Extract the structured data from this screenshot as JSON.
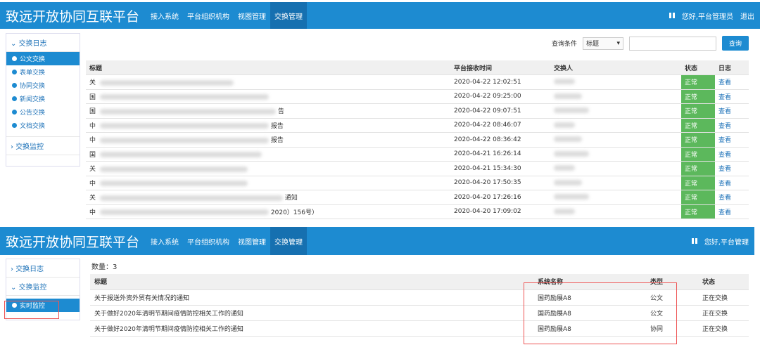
{
  "top": {
    "app_title": "致远开放协同互联平台",
    "nav": [
      "接入系统",
      "平台组织机构",
      "视图管理",
      "交换管理"
    ],
    "greeting": "您好,平台管理员",
    "logout": "退出"
  },
  "top_sidebar": {
    "sections": [
      "交换日志",
      "交换监控"
    ],
    "items": [
      "公文交换",
      "表单交换",
      "协同交换",
      "新闻交换",
      "公告交换",
      "文档交换"
    ]
  },
  "filter": {
    "label": "查询条件",
    "select": "标题",
    "button": "查询"
  },
  "log_table": {
    "headers": [
      "标题",
      "平台接收时间",
      "交换人",
      "状态",
      "日志"
    ],
    "rows": [
      {
        "title": "关",
        "suffix": "",
        "time": "2020-04-22 12:02:51",
        "status": "正常",
        "log": "查看"
      },
      {
        "title": "国",
        "suffix": "",
        "time": "2020-04-22 09:25:00",
        "status": "正常",
        "log": "查看"
      },
      {
        "title": "国",
        "suffix": "告",
        "time": "2020-04-22 09:07:51",
        "status": "正常",
        "log": "查看"
      },
      {
        "title": "中",
        "suffix": "报告",
        "time": "2020-04-22 08:46:07",
        "status": "正常",
        "log": "查看"
      },
      {
        "title": "中",
        "suffix": "报告",
        "time": "2020-04-22 08:36:42",
        "status": "正常",
        "log": "查看"
      },
      {
        "title": "国",
        "suffix": "",
        "time": "2020-04-21 16:26:14",
        "status": "正常",
        "log": "查看"
      },
      {
        "title": "关",
        "suffix": "",
        "time": "2020-04-21 15:34:30",
        "status": "正常",
        "log": "查看"
      },
      {
        "title": "中",
        "suffix": "",
        "time": "2020-04-20 17:50:35",
        "status": "正常",
        "log": "查看"
      },
      {
        "title": "关",
        "suffix": "通知",
        "time": "2020-04-20 17:26:16",
        "status": "正常",
        "log": "查看"
      },
      {
        "title": "中",
        "suffix": "2020）156号）",
        "time": "2020-04-20 17:09:02",
        "status": "正常",
        "log": "查看"
      }
    ]
  },
  "bottom": {
    "app_title": "致远开放协同互联平台",
    "nav": [
      "接入系统",
      "平台组织机构",
      "视图管理",
      "交换管理"
    ],
    "greeting": "您好,平台管理"
  },
  "bottom_sidebar": {
    "sections": [
      "交换日志",
      "交换监控"
    ],
    "item": "实时监控"
  },
  "count": "数量：3",
  "monitor_table": {
    "headers": [
      "标题",
      "系统名称",
      "类型",
      "状态"
    ],
    "rows": [
      {
        "title": "关于报送外资外贸有关情况的通知",
        "system": "国药励展A8",
        "type": "公文",
        "status": "正在交换"
      },
      {
        "title": "关于做好2020年清明节期间疫情防控相关工作的通知",
        "system": "国药励展A8",
        "type": "公文",
        "status": "正在交换"
      },
      {
        "title": "关于做好2020年清明节期间疫情防控相关工作的通知",
        "system": "国药励展A8",
        "type": "协同",
        "status": "正在交换"
      }
    ]
  },
  "colors": {
    "header": "#1d8bd1",
    "status_ok": "#5cb85c"
  }
}
